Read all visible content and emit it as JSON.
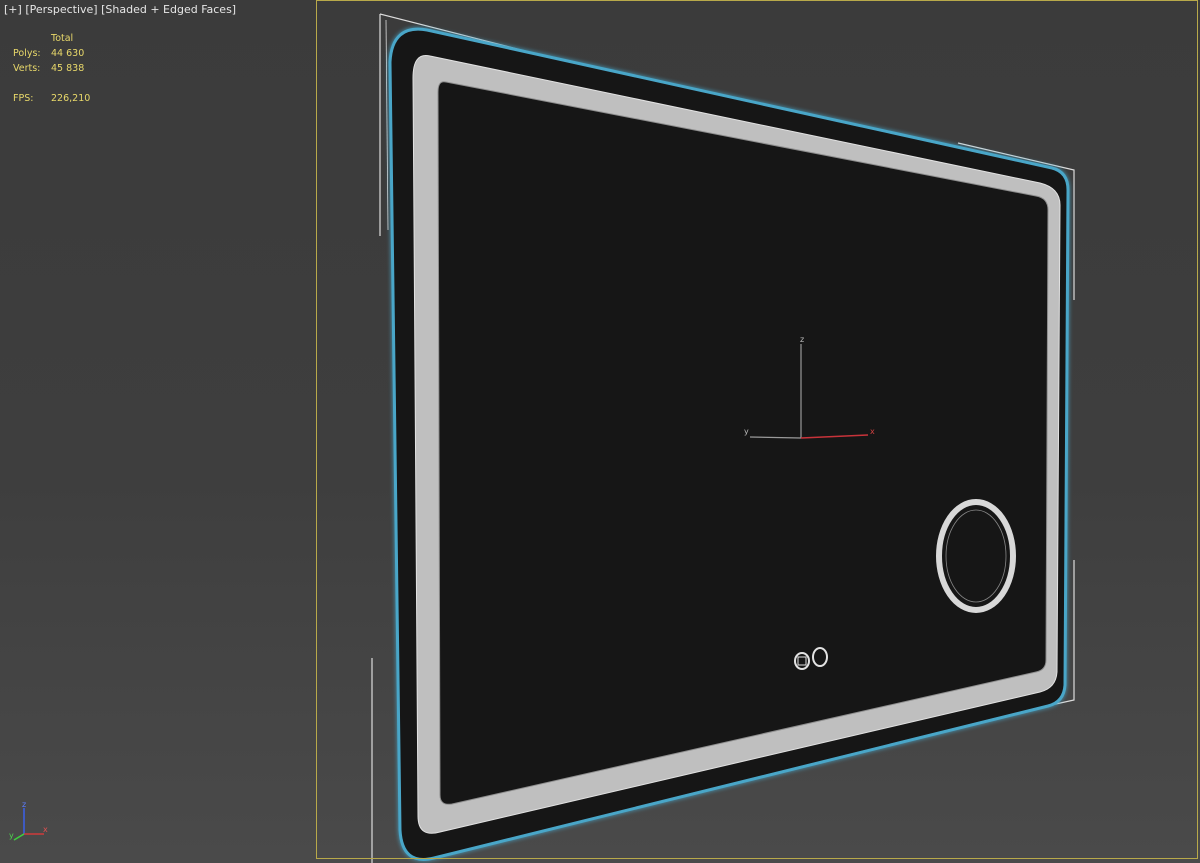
{
  "viewport": {
    "label_plus": "[+]",
    "label_view": "[Perspective]",
    "label_shading": "[Shaded + Edged Faces]"
  },
  "stats": {
    "header": "Total",
    "polys_label": "Polys:",
    "polys_value": "44 630",
    "verts_label": "Verts:",
    "verts_value": "45 838",
    "fps_label": "FPS:",
    "fps_value": "226,210"
  },
  "gizmo": {
    "z_label": "z",
    "y_label": "y",
    "x_label": "x"
  },
  "corner_axis": {
    "z_label": "z",
    "y_label": "y",
    "x_label": "x"
  },
  "colors": {
    "accent_selection_glow": "#4aa6c8",
    "safe_frame": "#b8a94a",
    "stats_text": "#e8d86a",
    "mirror_glass": "#151515",
    "led_strip": "#bdbdbd"
  }
}
